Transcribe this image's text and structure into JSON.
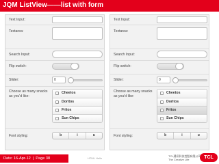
{
  "header": {
    "title": "JQM ListView——list with form"
  },
  "form": {
    "text_input_label": "Text Input:",
    "textarea_label": "Textarea:",
    "search_label": "Search Input:",
    "flip_label": "Flip switch:",
    "slider_label": "Slider:",
    "slider_value": "0",
    "slider_level": 0,
    "checkbox_label": "Choose as many snacks as you'd like:",
    "snacks": [
      "Cheetos",
      "Doritos",
      "Fritos",
      "Sun Chips"
    ],
    "right_selected_snack": "Fritos",
    "font_label": "Font styling:",
    "font_buttons": [
      "b",
      "i",
      "u"
    ]
  },
  "footer": {
    "date": "Date: 16-Apr-12",
    "page": "Page 38",
    "tag": "HTML Hello",
    "logo_cn": "TCL通讯科技控股有限公司",
    "logo_en": "The Creative Life",
    "logo_text": "TCL"
  },
  "colors": {
    "accent": "#e3001b"
  }
}
